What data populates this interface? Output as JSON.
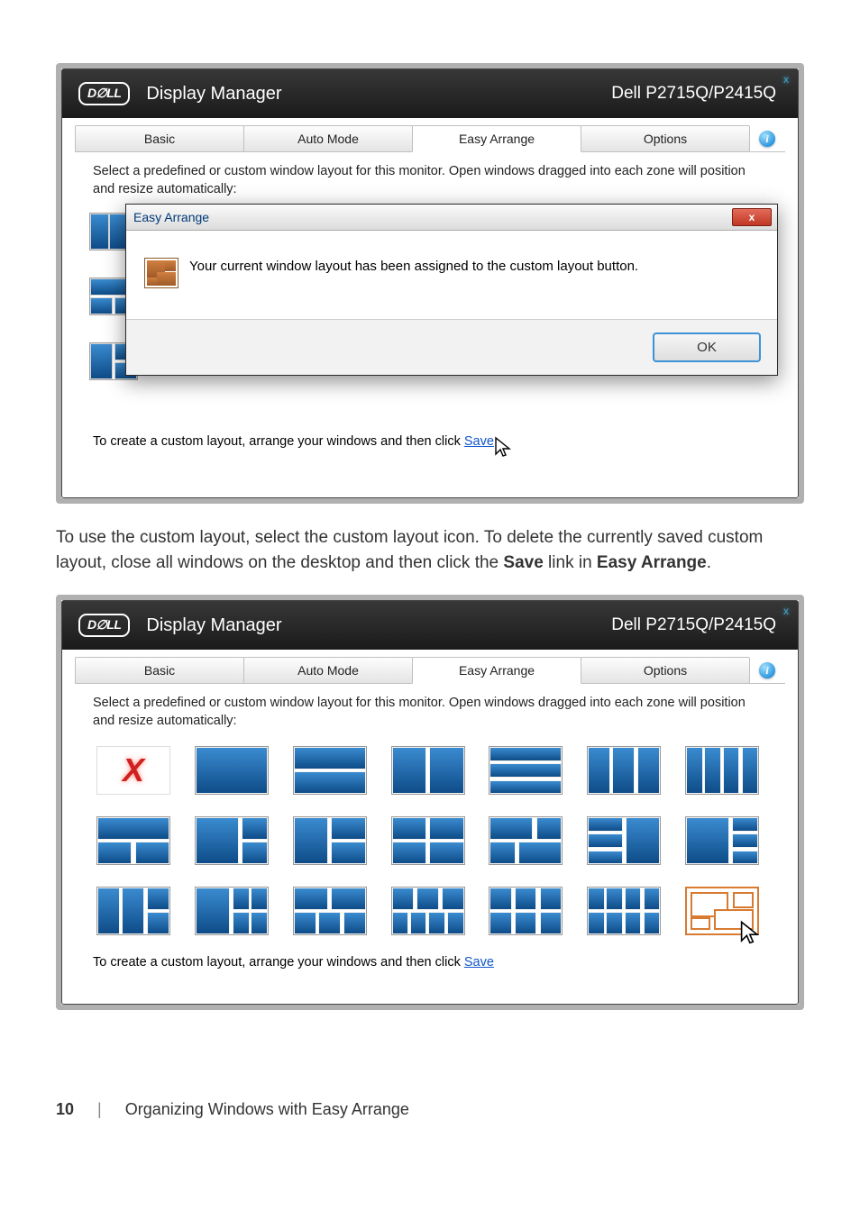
{
  "window1": {
    "app_title": "Display Manager",
    "monitor": "Dell P2715Q/P2415Q",
    "tabs": {
      "basic": "Basic",
      "auto": "Auto Mode",
      "easy": "Easy Arrange",
      "options": "Options"
    },
    "description": "Select a predefined or custom window layout for this monitor. Open windows dragged into each zone will position and resize automatically:",
    "modal": {
      "title": "Easy Arrange",
      "message": "Your current window layout has been assigned to the custom layout button.",
      "ok": "OK"
    },
    "footer_prefix": "To create a custom layout, arrange your windows and then click ",
    "footer_link": "Save"
  },
  "middle_paragraph": {
    "t1": "To use the custom layout, select the custom layout icon. To delete the currently saved custom layout, close all windows on the desktop and then click the ",
    "b1": "Save",
    "t2": " link in ",
    "b2": "Easy Arrange",
    "t3": "."
  },
  "window2": {
    "app_title": "Display Manager",
    "monitor": "Dell P2715Q/P2415Q",
    "tabs": {
      "basic": "Basic",
      "auto": "Auto Mode",
      "easy": "Easy Arrange",
      "options": "Options"
    },
    "description": "Select a predefined or custom window layout for this monitor. Open windows dragged into each zone will position and resize automatically:",
    "footer_prefix": "To create a custom layout, arrange your windows and then click ",
    "footer_link": "Save"
  },
  "page_footer": {
    "number": "10",
    "section": "Organizing Windows with Easy Arrange"
  }
}
